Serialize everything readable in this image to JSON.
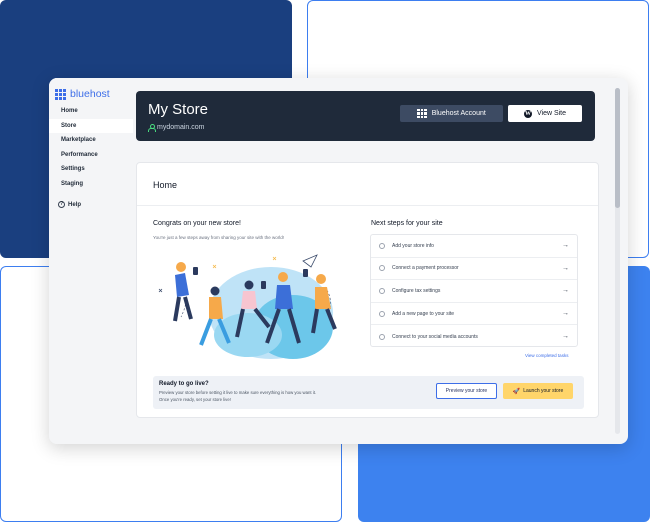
{
  "brand": {
    "logo_text": "bluehost",
    "color": "#3d6ee8"
  },
  "sidebar": {
    "items": [
      {
        "label": "Home"
      },
      {
        "label": "Store",
        "active": true
      },
      {
        "label": "Marketplace"
      },
      {
        "label": "Performance"
      },
      {
        "label": "Settings"
      },
      {
        "label": "Staging"
      }
    ],
    "help_label": "Help"
  },
  "header": {
    "title": "My Store",
    "domain": "mydomain.com",
    "account_button": "Bluehost Account",
    "view_site_button": "View Site"
  },
  "card": {
    "title": "Home",
    "congrats_title": "Congrats on your new store!",
    "congrats_sub": "You're just a few steps away from sharing your site with the world!",
    "next_steps_title": "Next steps for your site",
    "tasks": [
      {
        "label": "Add your store info",
        "arrow": "→"
      },
      {
        "label": "Connect a payment processor",
        "arrow": "→"
      },
      {
        "label": "Configure tax settings",
        "arrow": "→"
      },
      {
        "label": "Add a new page to your site",
        "arrow": "→"
      },
      {
        "label": "Connect to your social media accounts",
        "arrow": "→"
      }
    ],
    "view_completed": "View completed tasks",
    "golive": {
      "title": "Ready to go live?",
      "desc_line1": "Preview your store before setting it live to make sure everything is how you want it.",
      "desc_line2": "Once you're ready, set your store live!",
      "preview_button": "Preview your store",
      "launch_button": "Launch your store"
    }
  },
  "colors": {
    "navy_panel": "#1a3f7f",
    "blue_panel": "#3d82ef",
    "header_bg": "#1f2a3a",
    "launch_yellow": "#ffd56a"
  }
}
